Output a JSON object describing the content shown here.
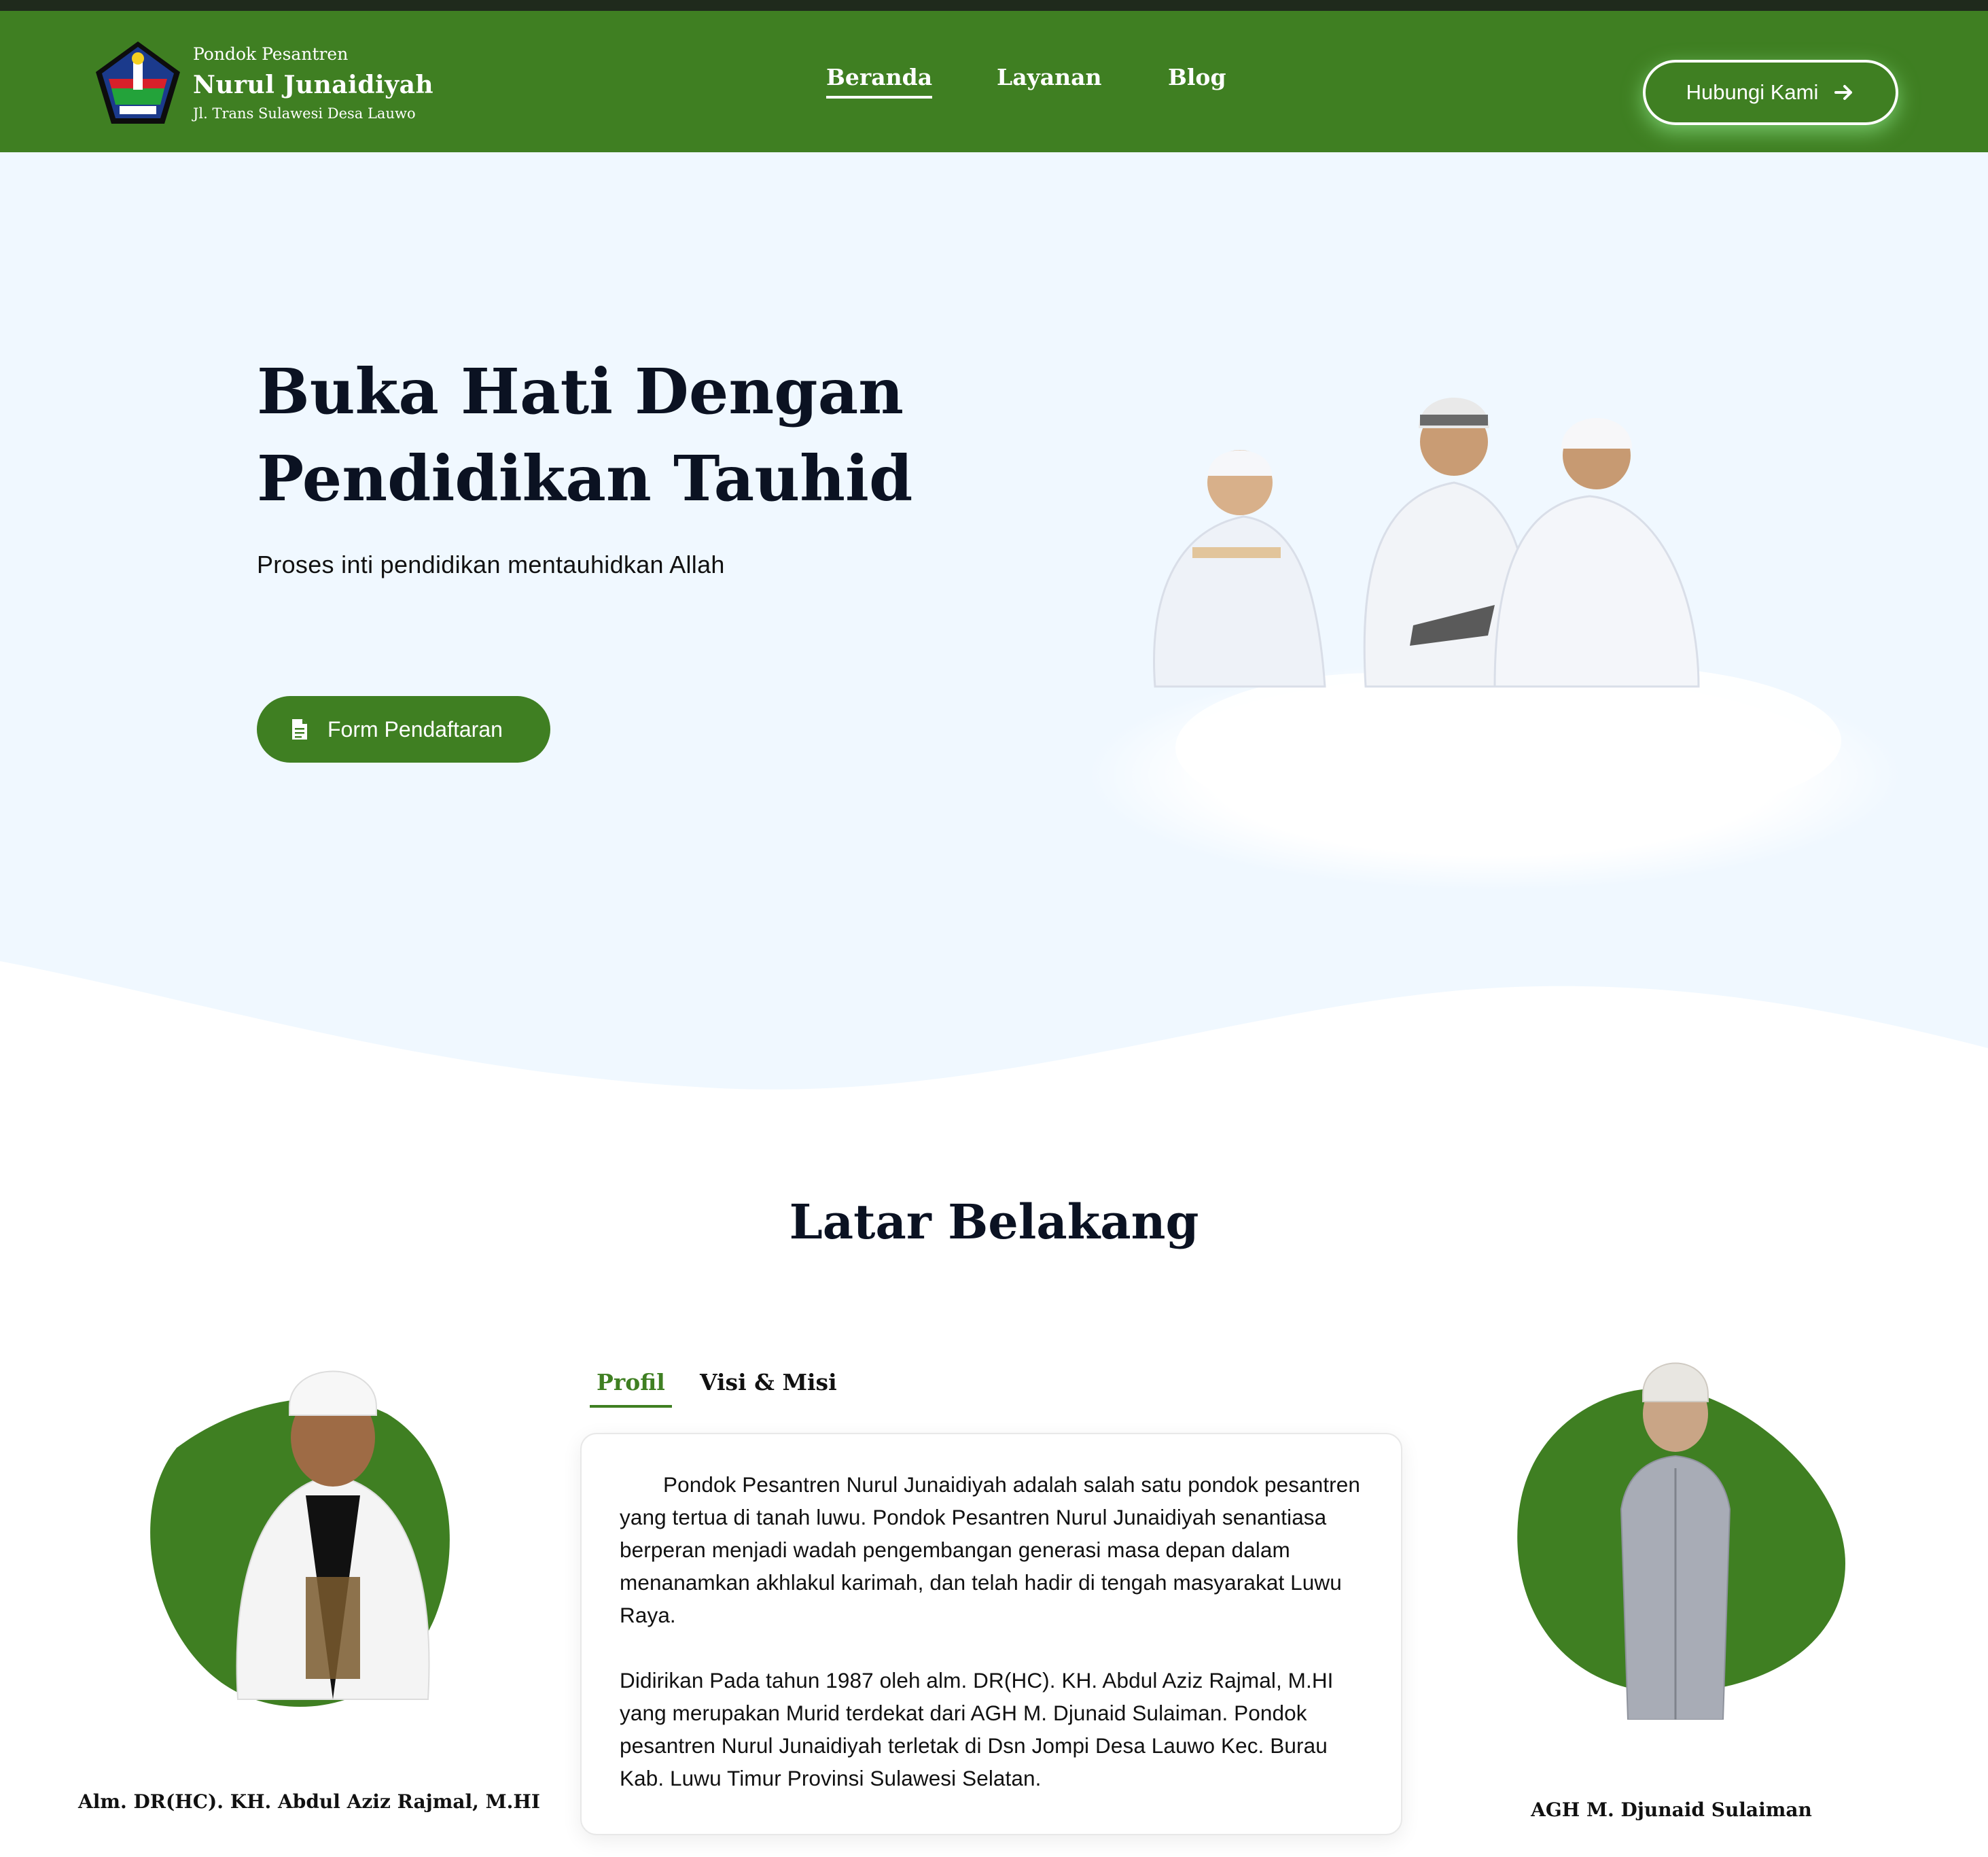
{
  "header": {
    "brand_sub": "Pondok Pesantren",
    "brand_name": "Nurul Junaidiyah",
    "brand_address": "Jl. Trans Sulawesi Desa Lauwo",
    "nav": [
      {
        "label": "Beranda",
        "active": true
      },
      {
        "label": "Layanan",
        "active": false
      },
      {
        "label": "Blog",
        "active": false
      }
    ],
    "cta_label": "Hubungi Kami",
    "cta_icon": "arrow-right-icon"
  },
  "hero": {
    "title_line1": "Buka Hati Dengan",
    "title_line2": "Pendidikan Tauhid",
    "subtitle": "Proses inti pendidikan mentauhidkan Allah",
    "button_label": "Form Pendaftaran",
    "button_icon": "document-icon"
  },
  "about": {
    "title": "Latar Belakang",
    "tabs": [
      {
        "label": "Profil",
        "active": true
      },
      {
        "label": "Visi & Misi",
        "active": false
      }
    ],
    "paragraph1": "Pondok Pesantren Nurul Junaidiyah adalah salah satu pondok pesantren yang tertua di tanah luwu. Pondok Pesantren Nurul Junaidiyah senantiasa berperan menjadi wadah pengembangan generasi masa depan dalam menanamkan akhlakul karimah, dan telah hadir di tengah masyarakat Luwu Raya.",
    "paragraph2": "Didirikan Pada tahun 1987 oleh alm. DR(HC). KH. Abdul Aziz Rajmal, M.HI yang merupakan Murid terdekat dari AGH M. Djunaid Sulaiman. Pondok pesantren Nurul Junaidiyah terletak di Dsn Jompi Desa Lauwo Kec. Burau Kab. Luwu Timur Provinsi Sulawesi Selatan.",
    "caption_left": "Alm. DR(HC). KH. Abdul Aziz Rajmal, M.HI",
    "caption_right": "AGH M. Djunaid Sulaiman"
  },
  "colors": {
    "brand_green": "#3f7f22",
    "hero_bg": "#f0f8ff",
    "text_dark": "#0b1222"
  }
}
